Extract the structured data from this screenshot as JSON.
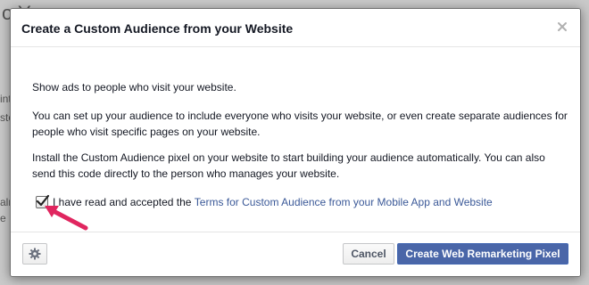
{
  "background": {
    "title_fragment": "o You",
    "fragments": [
      "int",
      "sto",
      "alr",
      "e"
    ]
  },
  "dialog": {
    "title": "Create a Custom Audience from your Website",
    "close_icon": "close-icon",
    "paragraphs": {
      "intro": "Show ads to people who visit your website.",
      "setup": "You can set up your audience to include everyone who visits your website, or even create separate audiences for people who visit specific pages on your website.",
      "install": "Install the Custom Audience pixel on your website to start building your audience automatically. You can also send this code directly to the person who manages your website."
    },
    "terms": {
      "checked": true,
      "prefix": "I have read and accepted the",
      "link": "Terms for Custom Audience from your Mobile App and Website"
    },
    "footer": {
      "settings_icon": "gear-icon",
      "cancel_label": "Cancel",
      "primary_label": "Create Web Remarketing Pixel"
    }
  },
  "colors": {
    "link": "#3b5998",
    "primary_button": "#4a66a8",
    "annotation_arrow": "#e0265f"
  }
}
